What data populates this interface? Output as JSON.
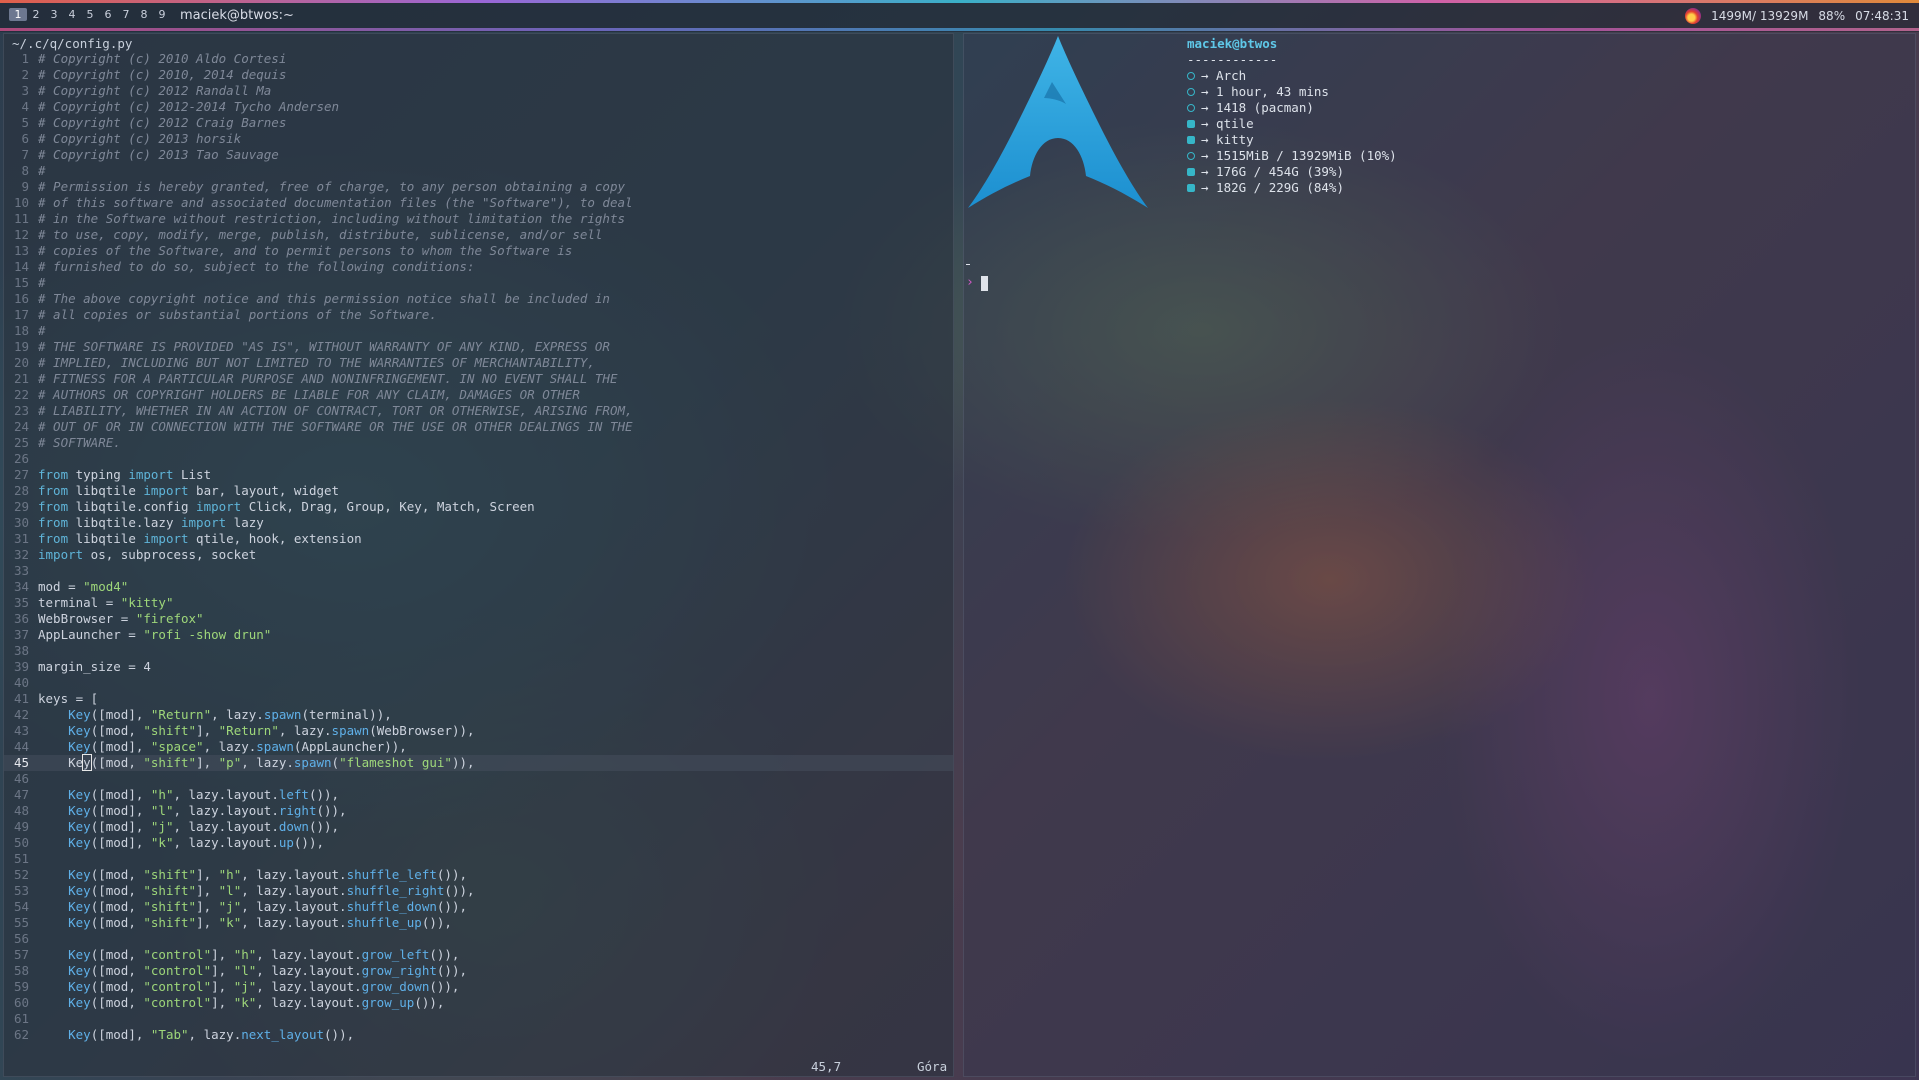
{
  "topbar": {
    "workspaces": [
      "1",
      "2",
      "3",
      "4",
      "5",
      "6",
      "7",
      "8",
      "9"
    ],
    "active_workspace": "1",
    "window_title": "maciek@btwos:~",
    "memory": "1499M/ 13929M",
    "battery": "88%",
    "clock": "07:48:31"
  },
  "editor": {
    "path": "~/.c/q/config.py",
    "cursor_position": "45,7",
    "scroll_position": "Góra",
    "current_line": 45,
    "lines": [
      "# Copyright (c) 2010 Aldo Cortesi",
      "# Copyright (c) 2010, 2014 dequis",
      "# Copyright (c) 2012 Randall Ma",
      "# Copyright (c) 2012-2014 Tycho Andersen",
      "# Copyright (c) 2012 Craig Barnes",
      "# Copyright (c) 2013 horsik",
      "# Copyright (c) 2013 Tao Sauvage",
      "#",
      "# Permission is hereby granted, free of charge, to any person obtaining a copy",
      "# of this software and associated documentation files (the \"Software\"), to deal",
      "# in the Software without restriction, including without limitation the rights",
      "# to use, copy, modify, merge, publish, distribute, sublicense, and/or sell",
      "# copies of the Software, and to permit persons to whom the Software is",
      "# furnished to do so, subject to the following conditions:",
      "#",
      "# The above copyright notice and this permission notice shall be included in",
      "# all copies or substantial portions of the Software.",
      "#",
      "# THE SOFTWARE IS PROVIDED \"AS IS\", WITHOUT WARRANTY OF ANY KIND, EXPRESS OR",
      "# IMPLIED, INCLUDING BUT NOT LIMITED TO THE WARRANTIES OF MERCHANTABILITY,",
      "# FITNESS FOR A PARTICULAR PURPOSE AND NONINFRINGEMENT. IN NO EVENT SHALL THE",
      "# AUTHORS OR COPYRIGHT HOLDERS BE LIABLE FOR ANY CLAIM, DAMAGES OR OTHER",
      "# LIABILITY, WHETHER IN AN ACTION OF CONTRACT, TORT OR OTHERWISE, ARISING FROM,",
      "# OUT OF OR IN CONNECTION WITH THE SOFTWARE OR THE USE OR OTHER DEALINGS IN THE",
      "# SOFTWARE.",
      "",
      "from typing import List",
      "from libqtile import bar, layout, widget",
      "from libqtile.config import Click, Drag, Group, Key, Match, Screen",
      "from libqtile.lazy import lazy",
      "from libqtile import qtile, hook, extension",
      "import os, subprocess, socket",
      "",
      "mod = \"mod4\"",
      "terminal = \"kitty\"",
      "WebBrowser = \"firefox\"",
      "AppLauncher = \"rofi -show drun\"",
      "",
      "margin_size = 4",
      "",
      "keys = [",
      "    Key([mod], \"Return\", lazy.spawn(terminal)),",
      "    Key([mod, \"shift\"], \"Return\", lazy.spawn(WebBrowser)),",
      "    Key([mod], \"space\", lazy.spawn(AppLauncher)),",
      "    Key([mod, \"shift\"], \"p\", lazy.spawn(\"flameshot gui\")),",
      "",
      "    Key([mod], \"h\", lazy.layout.left()),",
      "    Key([mod], \"l\", lazy.layout.right()),",
      "    Key([mod], \"j\", lazy.layout.down()),",
      "    Key([mod], \"k\", lazy.layout.up()),",
      "",
      "    Key([mod, \"shift\"], \"h\", lazy.layout.shuffle_left()),",
      "    Key([mod, \"shift\"], \"l\", lazy.layout.shuffle_right()),",
      "    Key([mod, \"shift\"], \"j\", lazy.layout.shuffle_down()),",
      "    Key([mod, \"shift\"], \"k\", lazy.layout.shuffle_up()),",
      "",
      "    Key([mod, \"control\"], \"h\", lazy.layout.grow_left()),",
      "    Key([mod, \"control\"], \"l\", lazy.layout.grow_right()),",
      "    Key([mod, \"control\"], \"j\", lazy.layout.grow_down()),",
      "    Key([mod, \"control\"], \"k\", lazy.layout.grow_up()),",
      "",
      "    Key([mod], \"Tab\", lazy.next_layout()),"
    ]
  },
  "terminal": {
    "user_host": "maciek@btwos",
    "separator": "------------",
    "info": [
      {
        "icon": "arch-icon",
        "text": "→ Arch"
      },
      {
        "icon": "uptime-icon",
        "text": "→ 1 hour, 43 mins"
      },
      {
        "icon": "package-icon",
        "text": "→ 1418 (pacman)"
      },
      {
        "icon": "wm-icon",
        "text": "→ qtile"
      },
      {
        "icon": "terminal-icon",
        "text": "→ kitty"
      },
      {
        "icon": "memory-icon",
        "text": "→ 1515MiB / 13929MiB (10%)"
      },
      {
        "icon": "disk-icon",
        "text": "→ 176G / 454G (39%)"
      },
      {
        "icon": "disk-icon",
        "text": "→ 182G / 229G (84%)"
      }
    ],
    "prompt_symbol": "›",
    "colors": {
      "accent": "#36b6c8",
      "prompt": "#d45ac8"
    }
  }
}
